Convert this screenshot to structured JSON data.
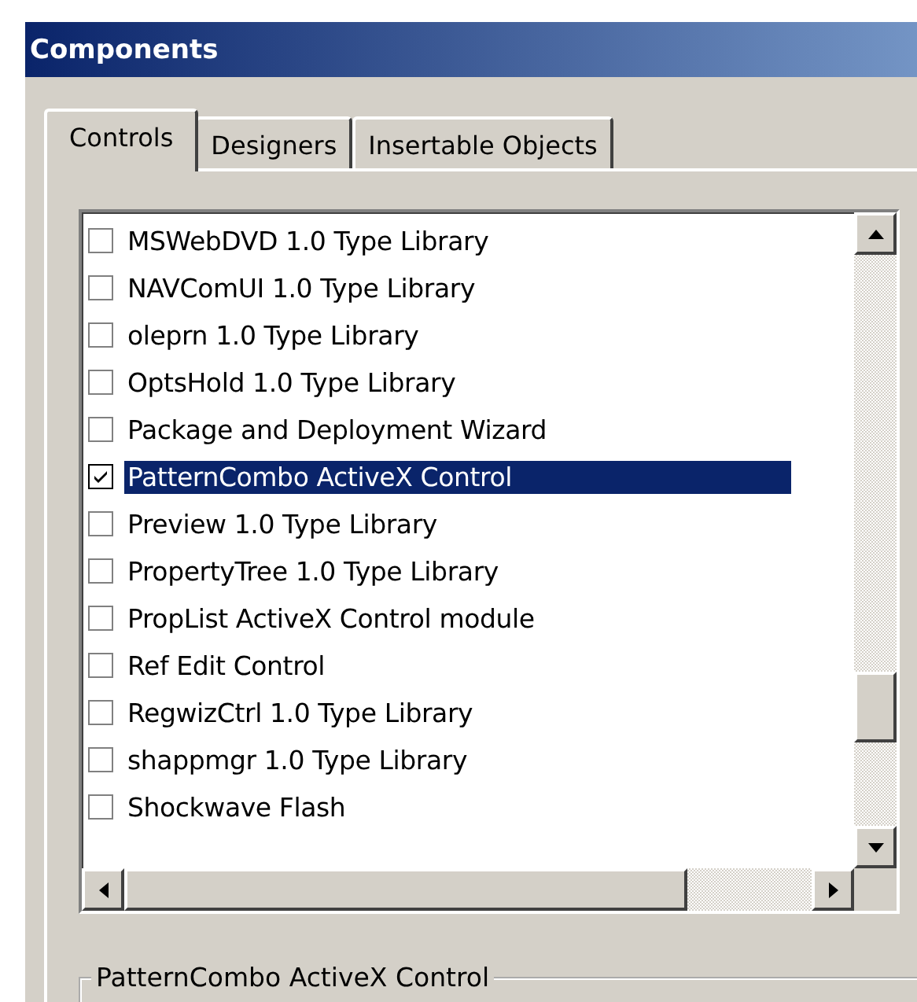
{
  "window": {
    "title": "Components"
  },
  "tabs": [
    {
      "label": "Controls",
      "selected": true
    },
    {
      "label": "Designers",
      "selected": false
    },
    {
      "label": "Insertable Objects",
      "selected": false
    }
  ],
  "list": {
    "items": [
      {
        "label": "MSWebDVD 1.0 Type Library",
        "checked": false,
        "selected": false
      },
      {
        "label": "NAVComUI 1.0 Type Library",
        "checked": false,
        "selected": false
      },
      {
        "label": "oleprn 1.0 Type Library",
        "checked": false,
        "selected": false
      },
      {
        "label": "OptsHold 1.0 Type Library",
        "checked": false,
        "selected": false
      },
      {
        "label": "Package and Deployment Wizard",
        "checked": false,
        "selected": false
      },
      {
        "label": "PatternCombo ActiveX Control",
        "checked": true,
        "selected": true
      },
      {
        "label": "Preview 1.0 Type Library",
        "checked": false,
        "selected": false
      },
      {
        "label": "PropertyTree 1.0 Type Library",
        "checked": false,
        "selected": false
      },
      {
        "label": "PropList ActiveX Control module",
        "checked": false,
        "selected": false
      },
      {
        "label": "Ref Edit Control",
        "checked": false,
        "selected": false
      },
      {
        "label": "RegwizCtrl 1.0 Type Library",
        "checked": false,
        "selected": false
      },
      {
        "label": "shappmgr 1.0 Type Library",
        "checked": false,
        "selected": false
      },
      {
        "label": "Shockwave Flash",
        "checked": false,
        "selected": false
      }
    ]
  },
  "group": {
    "title": "PatternCombo ActiveX Control"
  }
}
